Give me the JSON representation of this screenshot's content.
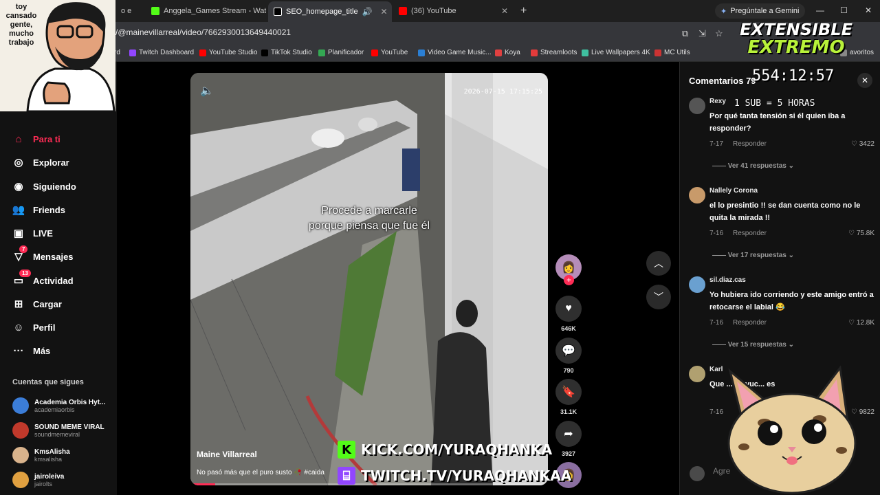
{
  "browser": {
    "tabs": [
      {
        "label": "o e",
        "color": "#555555"
      },
      {
        "label": "Anggela_Games Stream - Watc",
        "color": "#53fc18"
      },
      {
        "label": "SEO_homepage_title",
        "color": "#000000"
      },
      {
        "label": "(36) YouTube",
        "color": "#ff0000"
      }
    ],
    "gemini_label": "Pregúntale a Gemini",
    "url": "/@mainevillarreal/video/7662930013649440021",
    "bookmarks": [
      {
        "label": "rd",
        "color": "#888888"
      },
      {
        "label": "Twitch Dashboard",
        "color": "#9146ff"
      },
      {
        "label": "YouTube Studio",
        "color": "#ff0000"
      },
      {
        "label": "TikTok Studio",
        "color": "#000000"
      },
      {
        "label": "Planificador",
        "color": "#34a853"
      },
      {
        "label": "YouTube",
        "color": "#ff0000"
      },
      {
        "label": "Video Game Music...",
        "color": "#2b7fd4"
      },
      {
        "label": "Koya",
        "color": "#e04040"
      },
      {
        "label": "Streamloots",
        "color": "#e33b3b"
      },
      {
        "label": "Live Wallpapers 4K",
        "color": "#3fbf9f"
      },
      {
        "label": "MC Utils",
        "color": "#cc3333"
      },
      {
        "label": "avoritos",
        "color": "#888888"
      }
    ]
  },
  "streamer_overlay": {
    "text": "toy cansado gente, mucho trabajo"
  },
  "sidebar": {
    "items": [
      {
        "label": "Para ti",
        "icon": "home-icon",
        "active": true
      },
      {
        "label": "Explorar",
        "icon": "compass-icon"
      },
      {
        "label": "Siguiendo",
        "icon": "following-icon"
      },
      {
        "label": "Friends",
        "icon": "friends-icon"
      },
      {
        "label": "LIVE",
        "icon": "live-icon"
      },
      {
        "label": "Mensajes",
        "icon": "messages-icon",
        "badge": "7"
      },
      {
        "label": "Actividad",
        "icon": "activity-icon",
        "badge": "13"
      },
      {
        "label": "Cargar",
        "icon": "upload-icon"
      },
      {
        "label": "Perfil",
        "icon": "profile-icon"
      },
      {
        "label": "Más",
        "icon": "more-icon"
      }
    ],
    "following_title": "Cuentas que sigues",
    "accounts": [
      {
        "name": "Academia Orbis Hyt...",
        "handle": "academiaorbis",
        "color": "#3b7dd8"
      },
      {
        "name": "SOUND MEME VIRAL",
        "handle": "soundmemeviral",
        "color": "#c0392b"
      },
      {
        "name": "KmsAlisha",
        "handle": "kmsalisha",
        "color": "#d9b38c"
      },
      {
        "name": "jairoleiva",
        "handle": "jairolts",
        "color": "#e0a040"
      }
    ]
  },
  "video": {
    "timestamp": "2026-07-15 17:15:25",
    "caption_line1": "Procede a marcarle",
    "caption_line2": "porque piensa que fue él",
    "author": "Maine Villarreal",
    "description": "No pasó más que el puro susto 🥀 #caida",
    "progress": 0.07
  },
  "actions": {
    "likes": "646K",
    "comments": "790",
    "saves": "31.1K",
    "shares": "3927"
  },
  "comments": {
    "title": "Comentarios 79",
    "input_placeholder": "Agre",
    "items": [
      {
        "user": "Rexy",
        "text": "Por qué tanta tensión si él quien iba a responder?",
        "date": "7-17",
        "reply": "Responder",
        "likes": "3422",
        "replies": "Ver 41 respuestas",
        "color": "#555555"
      },
      {
        "user": "Nallely Corona",
        "text": "el lo presintio !! se dan cuenta como no le quita la mirada !!",
        "date": "7-16",
        "reply": "Responder",
        "likes": "75.8K",
        "replies": "Ver 17 respuestas",
        "color": "#c89a6a"
      },
      {
        "user": "sil.diaz.cas",
        "text": "Yo hubiera ido corriendo y este amigo entró a retocarse el labial 😂",
        "date": "7-16",
        "reply": "Responder",
        "likes": "12.8K",
        "replies": "Ver 15 respuestas",
        "color": "#6aa0d0"
      },
      {
        "user": "Karl",
        "text": "Que ... a ayuc... es",
        "date": "7-16",
        "reply": "",
        "likes": "9822",
        "replies": "",
        "color": "#b0a070"
      }
    ]
  },
  "stream": {
    "brand_line1": "EXTENSIBLE",
    "brand_line2": "EXTREMO",
    "timer": "554:12:57",
    "sub_info": "1 SUB = 5 HORAS",
    "kick": "KICK.COM/YURAQHANKA",
    "twitch": "TWITCH.TV/YURAQHANKAA"
  }
}
